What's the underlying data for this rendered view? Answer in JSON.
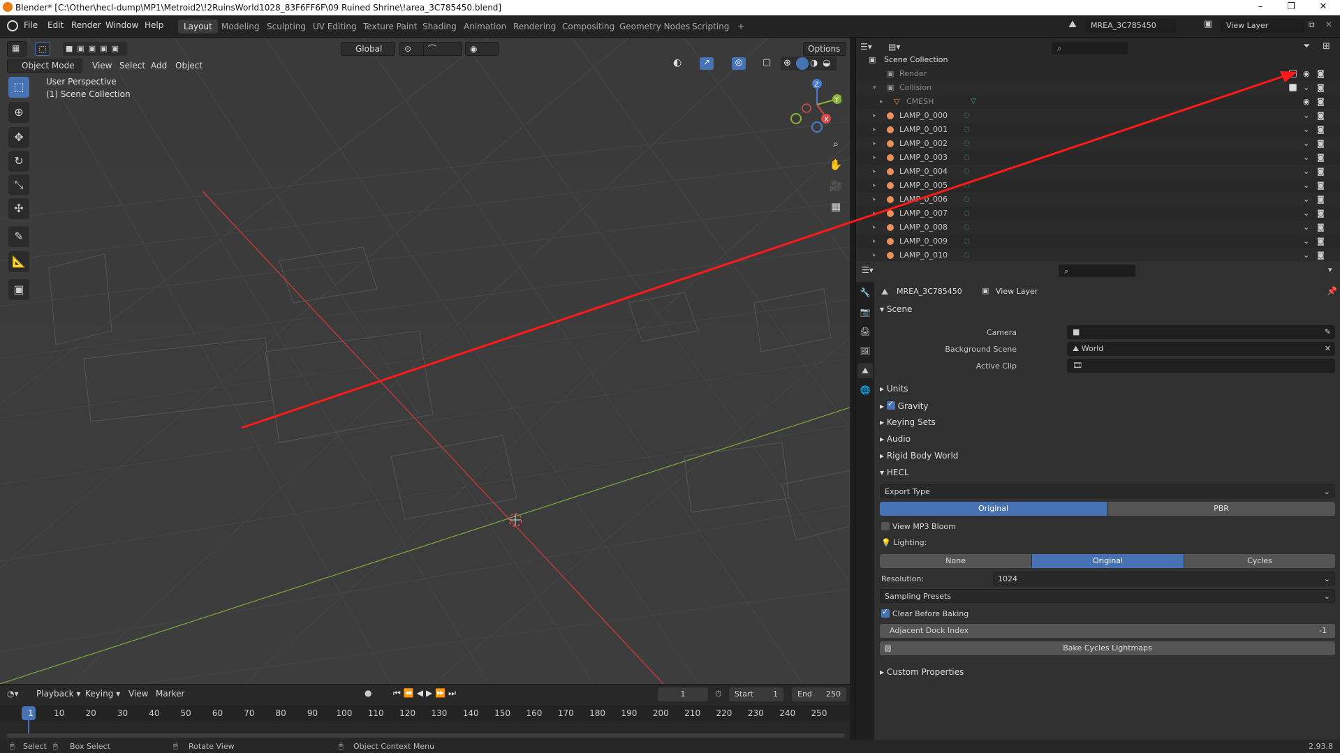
{
  "window": {
    "title": "Blender* [C:\\Other\\hecl-dump\\MP1\\Metroid2\\!2RuinsWorld1028_83F6FF6F\\09 Ruined Shrine\\!area_3C785450.blend]",
    "minimize": "–",
    "maximize": "❐",
    "close": "✕"
  },
  "menu": [
    "File",
    "Edit",
    "Render",
    "Window",
    "Help"
  ],
  "workspaces": [
    "Layout",
    "Modeling",
    "Sculpting",
    "UV Editing",
    "Texture Paint",
    "Shading",
    "Animation",
    "Rendering",
    "Compositing",
    "Geometry Nodes",
    "Scripting",
    "+"
  ],
  "scene_name": "MREA_3C785450",
  "view_layer": "View Layer",
  "viewport": {
    "mode": "Object Mode",
    "menus": [
      "View",
      "Select",
      "Add",
      "Object"
    ],
    "transform": "Global",
    "options": "Options",
    "perspective": "User Perspective",
    "collection": "(1) Scene Collection"
  },
  "outliner": {
    "root": "Scene Collection",
    "items": [
      {
        "name": "Render",
        "type": "collection",
        "dim": true
      },
      {
        "name": "Collision",
        "type": "collection",
        "dim": true
      },
      {
        "name": "CMESH",
        "type": "mesh",
        "dim": true
      },
      {
        "name": "LAMP_0_000",
        "type": "lamp"
      },
      {
        "name": "LAMP_0_001",
        "type": "lamp"
      },
      {
        "name": "LAMP_0_002",
        "type": "lamp"
      },
      {
        "name": "LAMP_0_003",
        "type": "lamp"
      },
      {
        "name": "LAMP_0_004",
        "type": "lamp"
      },
      {
        "name": "LAMP_0_005",
        "type": "lamp"
      },
      {
        "name": "LAMP_0_006",
        "type": "lamp"
      },
      {
        "name": "LAMP_0_007",
        "type": "lamp"
      },
      {
        "name": "LAMP_0_008",
        "type": "lamp"
      },
      {
        "name": "LAMP_0_009",
        "type": "lamp"
      },
      {
        "name": "LAMP_0_010",
        "type": "lamp"
      }
    ]
  },
  "properties": {
    "breadcrumb_scene": "MREA_3C785450",
    "breadcrumb_layer": "View Layer",
    "scene_section": "Scene",
    "camera_label": "Camera",
    "camera_value": "",
    "bg_label": "Background Scene",
    "bg_value": "World",
    "clip_label": "Active Clip",
    "clip_value": "",
    "units": "Units",
    "gravity": "Gravity",
    "keying_sets": "Keying Sets",
    "audio": "Audio",
    "rigid_body": "Rigid Body World",
    "hecl": "HECL",
    "export_type": "Export Type",
    "export_opts": [
      "Original",
      "PBR"
    ],
    "view_bloom": "View MP3 Bloom",
    "lighting_label": "Lighting:",
    "lighting_opts": [
      "None",
      "Original",
      "Cycles"
    ],
    "resolution_label": "Resolution:",
    "resolution_value": "1024",
    "sampling": "Sampling Presets",
    "clear_baking": "Clear Before Baking",
    "adj_dock_label": "Adjacent Dock Index",
    "adj_dock_value": "-1",
    "bake": "Bake Cycles Lightmaps",
    "custom_props": "Custom Properties"
  },
  "timeline": {
    "menus": [
      "Playback",
      "Keying",
      "View",
      "Marker"
    ],
    "current_frame": "1",
    "start_label": "Start",
    "start": "1",
    "end_label": "End",
    "end": "250",
    "ticks": [
      "1",
      "10",
      "20",
      "30",
      "40",
      "50",
      "60",
      "70",
      "80",
      "90",
      "100",
      "110",
      "120",
      "130",
      "140",
      "150",
      "160",
      "170",
      "180",
      "190",
      "200",
      "210",
      "220",
      "230",
      "240",
      "250"
    ]
  },
  "status": {
    "select": "Select",
    "box_select": "Box Select",
    "rotate": "Rotate View",
    "context": "Object Context Menu",
    "version": "2.93.8"
  },
  "colors": {
    "accent": "#4772b3",
    "x_axis": "#c93a3a",
    "y_axis": "#7da33a",
    "annotation": "#ff1a1a"
  }
}
